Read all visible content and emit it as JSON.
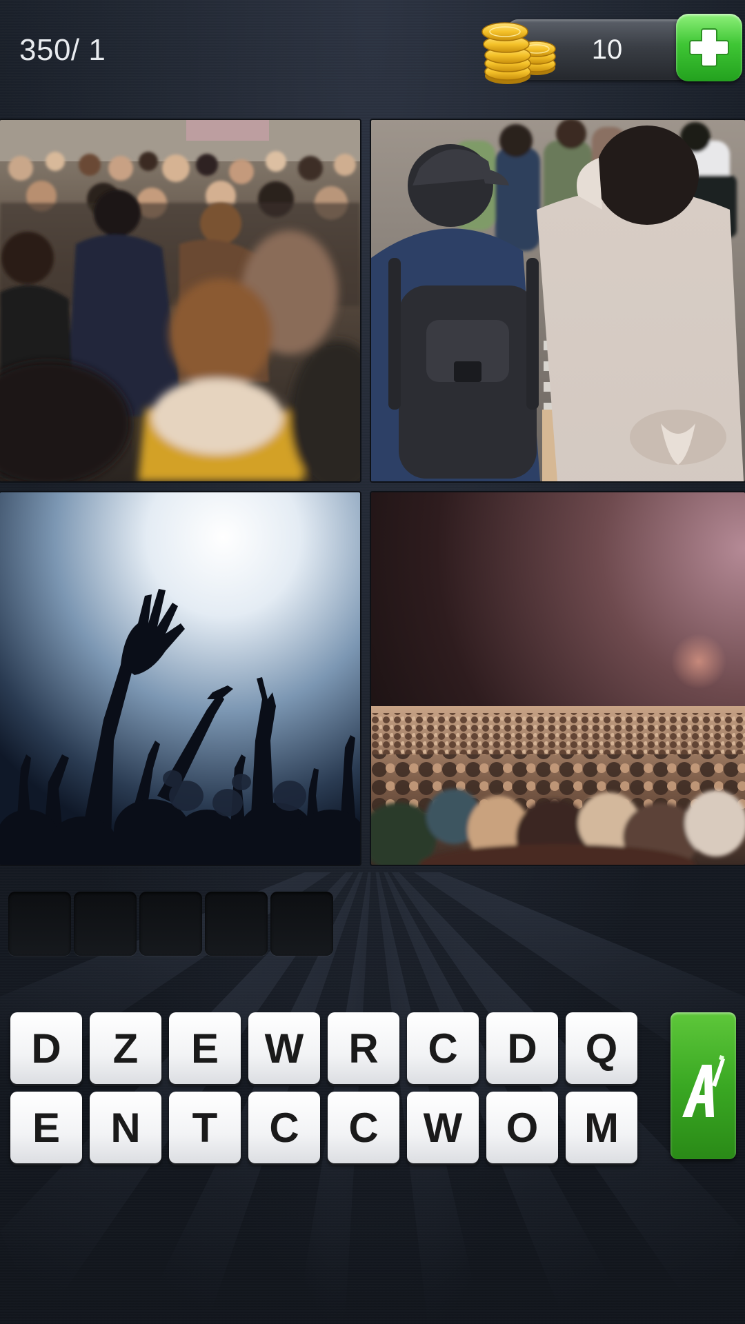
{
  "header": {
    "level_label": "350/ 1",
    "coin_count": "10"
  },
  "photos": [
    {
      "name": "crowd-street"
    },
    {
      "name": "people-backpack"
    },
    {
      "name": "concert-hands"
    },
    {
      "name": "audience-crowd"
    }
  ],
  "answer": {
    "slots": [
      "",
      "",
      "",
      "",
      ""
    ]
  },
  "keyboard": {
    "row1": [
      "D",
      "Z",
      "E",
      "W",
      "R",
      "C",
      "D",
      "Q"
    ],
    "row2": [
      "E",
      "N",
      "T",
      "C",
      "C",
      "W",
      "O",
      "M"
    ]
  },
  "icons": {
    "coins": "coins-icon",
    "add": "plus-icon",
    "solve": "magic-wand-icon"
  },
  "colors": {
    "accent_green": "#3fc635",
    "key_text": "#1a1a1a",
    "background": "#14181f"
  }
}
